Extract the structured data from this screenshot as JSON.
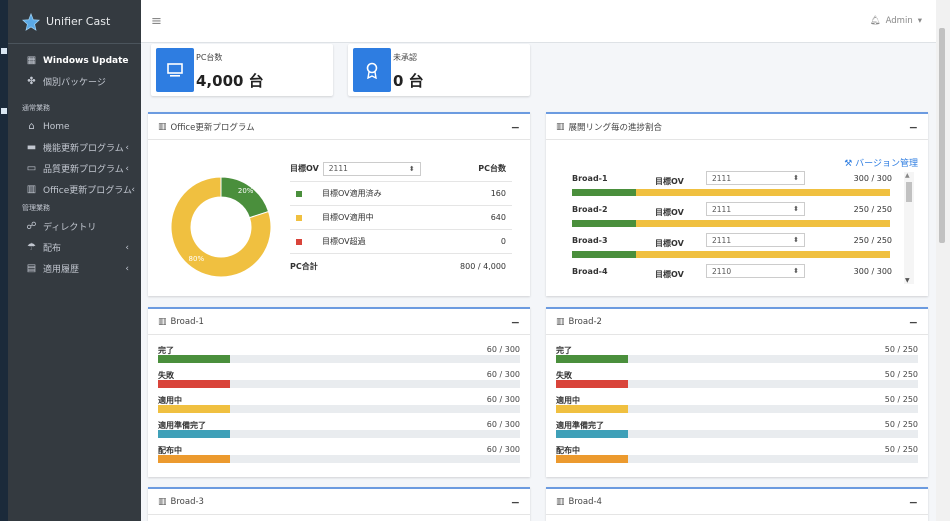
{
  "app": {
    "title": "Unifier Cast",
    "user": "Admin"
  },
  "colors": {
    "sidebar": "#343a40",
    "primary": "#2e7de1",
    "green": "#4a8f3c",
    "yellow": "#f0c040",
    "red": "#d9443a",
    "teal": "#3fa0b8",
    "orange": "#ec9a2e"
  },
  "sidebar": {
    "items": [
      {
        "label": "Windows Update",
        "icon": "windows-icon"
      },
      {
        "label": "個別パッケージ",
        "icon": "package-icon"
      }
    ],
    "section1": "通常業務",
    "ops": [
      {
        "label": "Home",
        "icon": "home-icon"
      },
      {
        "label": "機能更新プログラム",
        "icon": "feature-icon"
      },
      {
        "label": "品質更新プログラム",
        "icon": "quality-icon"
      },
      {
        "label": "Office更新プログラム",
        "icon": "chart-icon"
      }
    ],
    "section2": "管理業務",
    "mgmt": [
      {
        "label": "ディレクトリ",
        "icon": "directory-icon"
      },
      {
        "label": "配布",
        "icon": "distribute-icon"
      },
      {
        "label": "適用履歴",
        "icon": "history-icon"
      }
    ]
  },
  "info": [
    {
      "label": "PC台数",
      "value": "4,000 台"
    },
    {
      "label": "未承認",
      "value": "0 台"
    }
  ],
  "office": {
    "title": "Office更新プログラム",
    "target_label": "目標OV",
    "target_value": "2111",
    "pc_header": "PC台数",
    "rows": [
      {
        "label": "目標OV適用済み",
        "value": "160"
      },
      {
        "label": "目標OV適用中",
        "value": "640"
      },
      {
        "label": "目標OV超過",
        "value": "0"
      }
    ],
    "total_label": "PC合計",
    "total_value": "800 / 4,000",
    "donut": [
      {
        "label": "20%",
        "fraction": 0.2
      },
      {
        "label": "80%",
        "fraction": 0.8
      }
    ]
  },
  "rings": {
    "title": "展開リング毎の進捗割合",
    "version_link": "バージョン管理",
    "target_label": "目標OV",
    "items": [
      {
        "name": "Broad-1",
        "target": "2111",
        "count": "300 / 300",
        "green_fraction": 0.2
      },
      {
        "name": "Broad-2",
        "target": "2111",
        "count": "250 / 250",
        "green_fraction": 0.2
      },
      {
        "name": "Broad-3",
        "target": "2111",
        "count": "250 / 250",
        "green_fraction": 0.2
      },
      {
        "name": "Broad-4",
        "target": "2110",
        "count": "300 / 300",
        "green_fraction": 0.2
      }
    ]
  },
  "broad_cards": [
    {
      "title": "Broad-1",
      "rows": [
        {
          "label": "完了",
          "count": "60 / 300",
          "fraction": 0.2
        },
        {
          "label": "失敗",
          "count": "60 / 300",
          "fraction": 0.2
        },
        {
          "label": "適用中",
          "count": "60 / 300",
          "fraction": 0.2
        },
        {
          "label": "適用準備完了",
          "count": "60 / 300",
          "fraction": 0.2
        },
        {
          "label": "配布中",
          "count": "60 / 300",
          "fraction": 0.2
        }
      ]
    },
    {
      "title": "Broad-2",
      "rows": [
        {
          "label": "完了",
          "count": "50 / 250",
          "fraction": 0.2
        },
        {
          "label": "失敗",
          "count": "50 / 250",
          "fraction": 0.2
        },
        {
          "label": "適用中",
          "count": "50 / 250",
          "fraction": 0.2
        },
        {
          "label": "適用準備完了",
          "count": "50 / 250",
          "fraction": 0.2
        },
        {
          "label": "配布中",
          "count": "50 / 250",
          "fraction": 0.2
        }
      ]
    }
  ],
  "bottom_cards": [
    "Broad-3",
    "Broad-4"
  ]
}
